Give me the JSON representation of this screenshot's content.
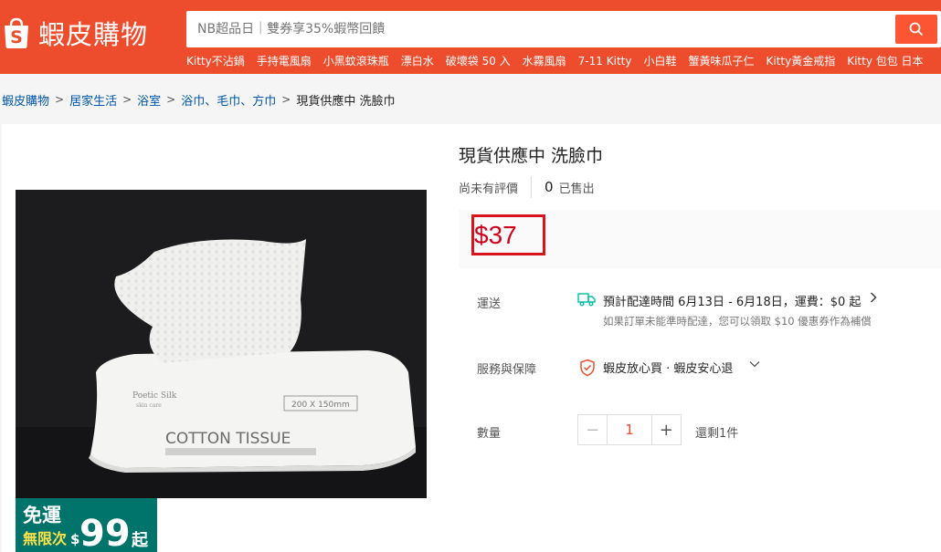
{
  "colors": {
    "brand": "#ee4d2d",
    "price": "#d0011b",
    "link": "#0055aa",
    "promo": "#00746a"
  },
  "header": {
    "logo_text": "蝦皮購物",
    "search_placeholder": "NB超品日｜雙券享35%蝦幣回饋",
    "hot_keywords": [
      "Kitty不沾鍋",
      "手持電風扇",
      "小黑蚊滾珠瓶",
      "漂白水",
      "破壞袋 50 入",
      "水霧風扇",
      "7-11 Kitty",
      "小白鞋",
      "蟹黃味瓜子仁",
      "Kitty黃金戒指",
      "Kitty 包包 日本"
    ]
  },
  "breadcrumb": {
    "items": [
      "蝦皮購物",
      "居家生活",
      "浴室",
      "浴巾、毛巾、方巾"
    ],
    "current": "現貨供應中 洗臉巾"
  },
  "product": {
    "title": "現貨供應中 洗臉巾",
    "rating_text": "尚未有評價",
    "sold_count": "0",
    "sold_label": "已售出",
    "price": "$37",
    "image_text": {
      "package_label": "COTTON TISSUE",
      "brand": "Poetic Silk",
      "brand_sub": "skin care",
      "size": "200 X 150mm"
    }
  },
  "promo_badge": {
    "line1": "免運",
    "line2": "無限次",
    "amount": "99",
    "unit": "起",
    "currency": "$"
  },
  "shipping": {
    "label": "運送",
    "estimate": "預計配達時間 6月13日 - 6月18日，運費：$0 起",
    "note": "如果訂單未能準時配達，您可以領取 $10 優惠券作為補償"
  },
  "guarantee": {
    "label": "服務與保障",
    "text": "蝦皮放心買 · 蝦皮安心退"
  },
  "quantity": {
    "label": "數量",
    "value": "1",
    "minus": "−",
    "plus": "+",
    "stock": "還剩1件"
  }
}
